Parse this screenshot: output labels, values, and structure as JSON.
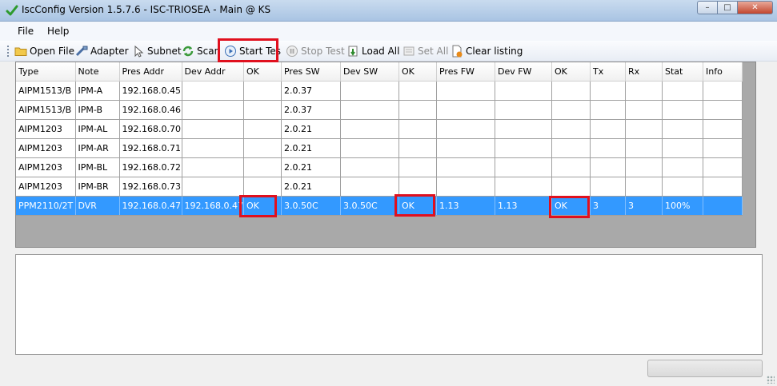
{
  "window": {
    "title": "IscConfig Version 1.5.7.6 - ISC-TRIOSEA - Main @ KS",
    "icon": "checkmark-icon",
    "minimize_label": "–",
    "maximize_label": "□",
    "close_label": "✕"
  },
  "menu": {
    "items": [
      {
        "label": "File"
      },
      {
        "label": "Help"
      }
    ]
  },
  "toolbar": {
    "buttons": [
      {
        "label": "Open File",
        "icon": "folder-icon",
        "enabled": true
      },
      {
        "label": "Adapter",
        "icon": "network-adapter-icon",
        "enabled": true
      },
      {
        "label": "Subnet",
        "icon": "cursor-icon",
        "enabled": true
      },
      {
        "label": "Scan",
        "icon": "refresh-icon",
        "enabled": true
      },
      {
        "label": "Start Tes",
        "icon": "play-icon",
        "enabled": true
      },
      {
        "label": "Stop Test",
        "icon": "pause-icon",
        "enabled": false
      },
      {
        "label": "Load All",
        "icon": "load-icon",
        "enabled": true
      },
      {
        "label": "Set All",
        "icon": "set-icon",
        "enabled": false
      },
      {
        "label": "Clear listing",
        "icon": "clear-document-icon",
        "enabled": true
      }
    ]
  },
  "grid": {
    "columns": [
      "Type",
      "Note",
      "Pres Addr",
      "Dev Addr",
      "OK",
      "Pres SW",
      "Dev SW",
      "OK",
      "Pres FW",
      "Dev FW",
      "OK",
      "Tx",
      "Rx",
      "Stat",
      "Info"
    ],
    "rows": [
      {
        "cells": [
          "AIPM1513/B",
          "IPM-A",
          "192.168.0.45",
          "",
          "",
          "2.0.37",
          "",
          "",
          "",
          "",
          "",
          "",
          "",
          "",
          ""
        ],
        "selected": false
      },
      {
        "cells": [
          "AIPM1513/B",
          "IPM-B",
          "192.168.0.46",
          "",
          "",
          "2.0.37",
          "",
          "",
          "",
          "",
          "",
          "",
          "",
          "",
          ""
        ],
        "selected": false
      },
      {
        "cells": [
          "AIPM1203",
          "IPM-AL",
          "192.168.0.70",
          "",
          "",
          "2.0.21",
          "",
          "",
          "",
          "",
          "",
          "",
          "",
          "",
          ""
        ],
        "selected": false
      },
      {
        "cells": [
          "AIPM1203",
          "IPM-AR",
          "192.168.0.71",
          "",
          "",
          "2.0.21",
          "",
          "",
          "",
          "",
          "",
          "",
          "",
          "",
          ""
        ],
        "selected": false
      },
      {
        "cells": [
          "AIPM1203",
          "IPM-BL",
          "192.168.0.72",
          "",
          "",
          "2.0.21",
          "",
          "",
          "",
          "",
          "",
          "",
          "",
          "",
          ""
        ],
        "selected": false
      },
      {
        "cells": [
          "AIPM1203",
          "IPM-BR",
          "192.168.0.73",
          "",
          "",
          "2.0.21",
          "",
          "",
          "",
          "",
          "",
          "",
          "",
          "",
          ""
        ],
        "selected": false
      },
      {
        "cells": [
          "PPM2110/2T",
          "DVR",
          "192.168.0.47",
          "192.168.0.47",
          "OK",
          "3.0.50C",
          "3.0.50C",
          "OK",
          "1.13",
          "1.13",
          "OK",
          "3",
          "3",
          "100%",
          ""
        ],
        "selected": true
      }
    ]
  },
  "colors": {
    "selection": "#3399ff",
    "highlight_box": "#e0101e",
    "progress": "#06b025"
  },
  "log": {
    "text": ""
  },
  "status": {
    "progress": 0
  }
}
